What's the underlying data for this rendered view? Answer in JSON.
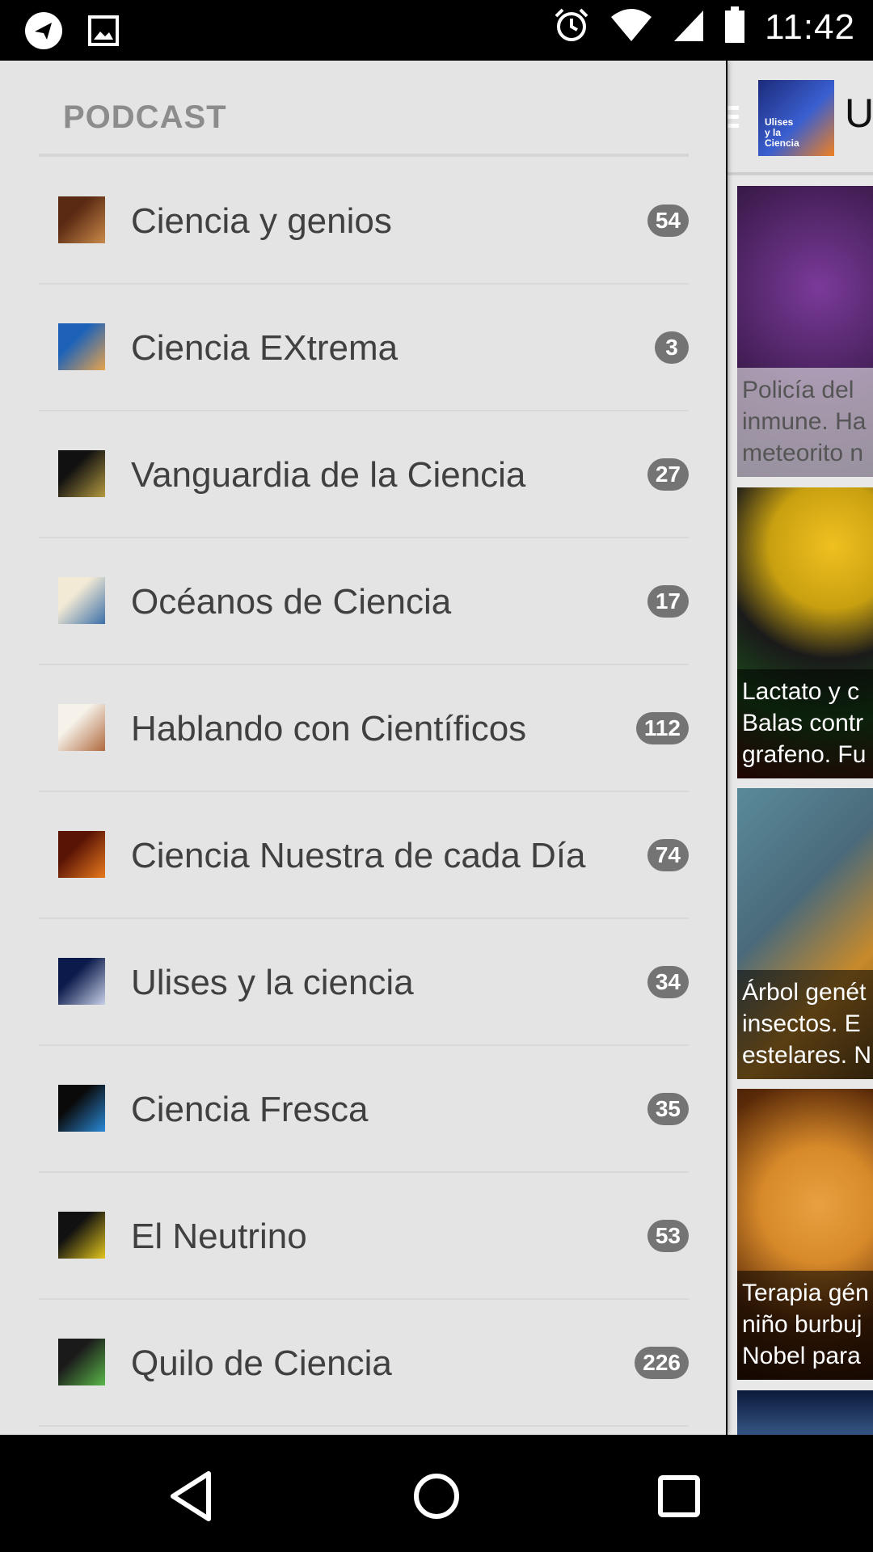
{
  "status_bar": {
    "time": "11:42",
    "left_icons": [
      "telegram-icon",
      "image-icon"
    ],
    "right_icons": [
      "alarm-icon",
      "wifi-icon",
      "signal-icon",
      "battery-icon"
    ]
  },
  "app_toolbar": {
    "title": "U",
    "logo_text": [
      "Ulises",
      "y la",
      "Ciencia"
    ]
  },
  "drawer": {
    "header": "PODCAST",
    "items": [
      {
        "label": "Ciencia y genios",
        "count": "54",
        "icon_colors": [
          "#5a2a12",
          "#c98a4a"
        ]
      },
      {
        "label": "Ciencia EXtrema",
        "count": "3",
        "icon_colors": [
          "#1d62b8",
          "#e7a34c"
        ]
      },
      {
        "label": "Vanguardia de la Ciencia",
        "count": "27",
        "icon_colors": [
          "#111111",
          "#b59a40"
        ]
      },
      {
        "label": "Océanos de Ciencia",
        "count": "17",
        "icon_colors": [
          "#f3ead5",
          "#3b6fa8"
        ]
      },
      {
        "label": "Hablando con Científicos",
        "count": "112",
        "icon_colors": [
          "#f6f2ea",
          "#b06a3e"
        ]
      },
      {
        "label": "Ciencia Nuestra de cada Día",
        "count": "74",
        "icon_colors": [
          "#5a1406",
          "#e87a1c"
        ]
      },
      {
        "label": "Ulises y la ciencia",
        "count": "34",
        "icon_colors": [
          "#0b1a4a",
          "#c8d0e8"
        ]
      },
      {
        "label": "Ciencia Fresca",
        "count": "35",
        "icon_colors": [
          "#0a0a0a",
          "#2a8ad8"
        ]
      },
      {
        "label": "El Neutrino",
        "count": "53",
        "icon_colors": [
          "#111111",
          "#e2c51c"
        ]
      },
      {
        "label": "Quilo de Ciencia",
        "count": "226",
        "icon_colors": [
          "#1a1a1a",
          "#5bb84a"
        ]
      }
    ]
  },
  "cards": [
    {
      "lines": [
        "Policía del",
        "inmune. Ha",
        "meteorito n"
      ],
      "colors": [
        "#3a1a4a",
        "#7a3a9a"
      ]
    },
    {
      "lines": [
        "Lactato y c",
        "Balas contr",
        "grafeno. Fu"
      ],
      "colors": [
        "#1a1a1a",
        "#c8a010"
      ]
    },
    {
      "lines": [
        "Árbol genét",
        "insectos. E",
        "estelares. N"
      ],
      "colors": [
        "#4a6a7a",
        "#c88a2a"
      ]
    },
    {
      "lines": [
        "Terapia gén",
        "niño burbuj",
        "Nobel para"
      ],
      "colors": [
        "#3a1a08",
        "#d88a2a"
      ]
    }
  ],
  "nav": {
    "buttons": [
      "back-icon",
      "home-icon",
      "recents-icon"
    ]
  }
}
